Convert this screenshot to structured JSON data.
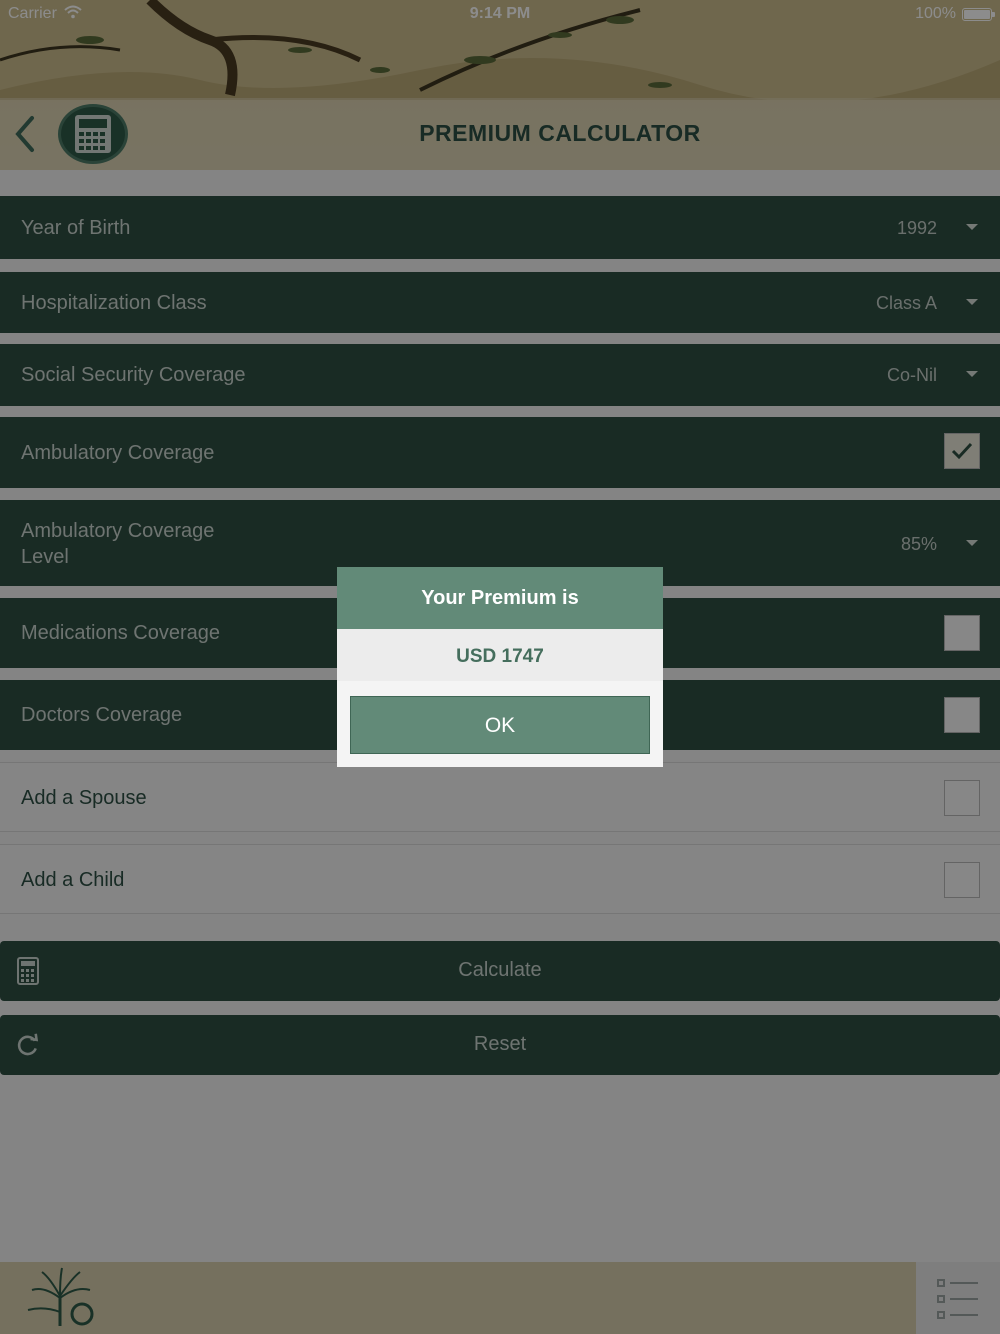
{
  "status_bar": {
    "carrier": "Carrier",
    "time": "9:14 PM",
    "battery": "100%"
  },
  "header": {
    "title": "PREMIUM CALCULATOR"
  },
  "form": {
    "year_of_birth": {
      "label": "Year of Birth",
      "value": "1992"
    },
    "hospitalization_class": {
      "label": "Hospitalization Class",
      "value": "Class A"
    },
    "social_security": {
      "label": "Social Security Coverage",
      "value": "Co-Nil"
    },
    "ambulatory": {
      "label": "Ambulatory Coverage",
      "checked": true
    },
    "ambulatory_level": {
      "label_line1": "Ambulatory Coverage",
      "label_line2": "Level",
      "value": "85%"
    },
    "medications": {
      "label": "Medications Coverage",
      "checked": false
    },
    "doctors": {
      "label": "Doctors Coverage",
      "checked": false
    },
    "spouse": {
      "label": "Add a Spouse",
      "checked": false
    },
    "child": {
      "label": "Add a Child",
      "checked": false
    }
  },
  "actions": {
    "calculate": "Calculate",
    "reset": "Reset"
  },
  "dialog": {
    "title": "Your Premium is",
    "amount": "USD 1747",
    "ok": "OK"
  },
  "colors": {
    "row_bg": "#2f4f43",
    "dialog_accent": "#628a78",
    "header_title": "#2d4f44"
  }
}
